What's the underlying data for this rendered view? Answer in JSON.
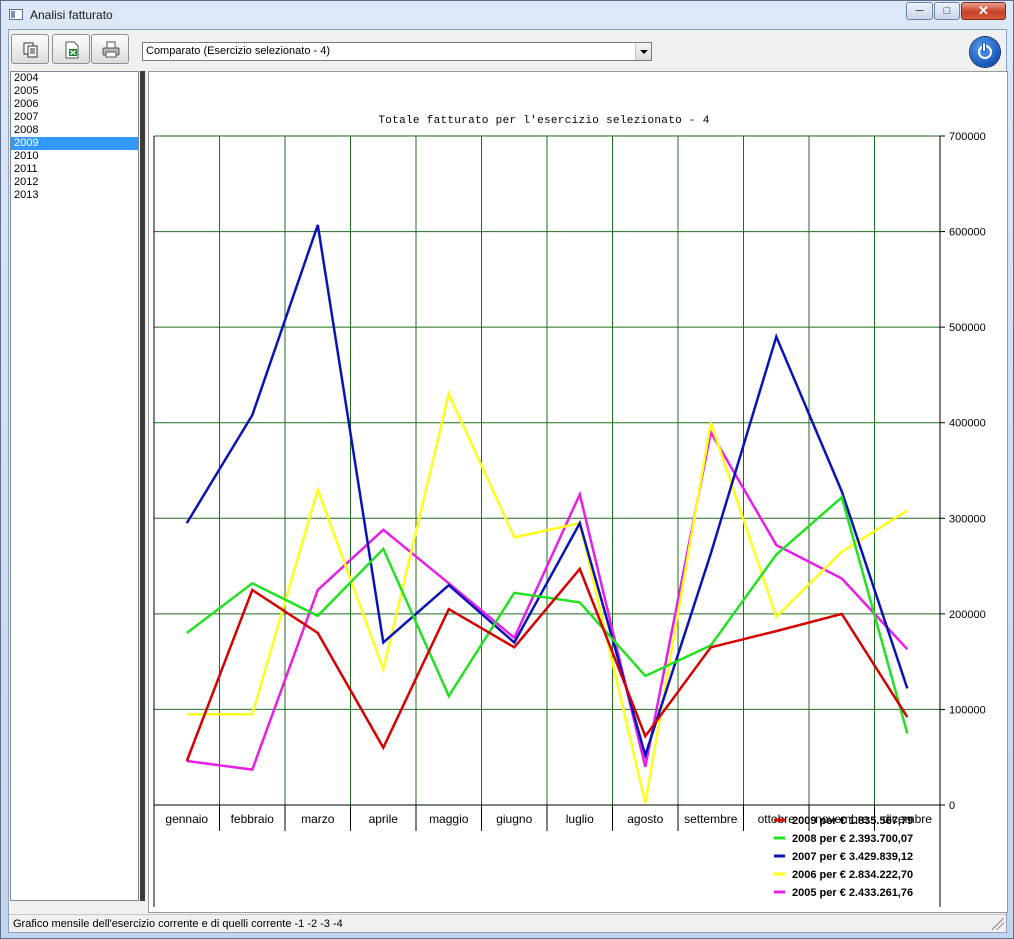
{
  "window": {
    "title": "Analisi fatturato",
    "minimize_glyph": "─",
    "maximize_glyph": "□",
    "close_glyph": "✕"
  },
  "toolbar": {
    "copy_icon": "copy-icon",
    "excel_icon": "excel-export-icon",
    "print_icon": "printer-icon",
    "power_icon": "power-icon"
  },
  "view_select": {
    "value": "Comparato (Esercizio selezionato - 4)"
  },
  "years": [
    "2004",
    "2005",
    "2006",
    "2007",
    "2008",
    "2009",
    "2010",
    "2011",
    "2012",
    "2013"
  ],
  "selected_year": "2009",
  "status": {
    "text": "Grafico mensile dell'esercizio corrente e di quelli corrente -1  -2  -3  -4"
  },
  "chart_data": {
    "type": "line",
    "title": "Totale fatturato per l'esercizio selezionato - 4",
    "categories": [
      "gennaio",
      "febbraio",
      "marzo",
      "aprile",
      "maggio",
      "giugno",
      "luglio",
      "agosto",
      "settembre",
      "ottobre",
      "novembre",
      "dicembre"
    ],
    "y_axis": {
      "min": 0,
      "max": 700000,
      "ticks": [
        0,
        100000,
        200000,
        300000,
        400000,
        500000,
        600000,
        700000
      ],
      "position": "right"
    },
    "grid": true,
    "legend_position": "bottom-right",
    "series": [
      {
        "name": "2009 per € 1.835.567,79",
        "color": "#d40000",
        "values": [
          46000,
          225000,
          180000,
          60000,
          205000,
          165000,
          247000,
          72000,
          165000,
          182000,
          200000,
          92000
        ]
      },
      {
        "name": "2008 per € 2.393.700,07",
        "color": "#22e022",
        "values": [
          180000,
          232000,
          198000,
          268000,
          114000,
          222000,
          212000,
          135000,
          167000,
          262000,
          322000,
          75000
        ]
      },
      {
        "name": "2007 per € 3.429.839,12",
        "color": "#0a14b4",
        "values": [
          295000,
          408000,
          607000,
          170000,
          230000,
          170000,
          295000,
          52000,
          263000,
          490000,
          328000,
          122000
        ]
      },
      {
        "name": "2006 per € 2.834.222,70",
        "color": "#ffff1e",
        "values": [
          95000,
          95000,
          330000,
          142000,
          430000,
          280000,
          295000,
          2000,
          400000,
          197000,
          265000,
          308000
        ]
      },
      {
        "name": "2005 per € 2.433.261,76",
        "color": "#e61ee6",
        "values": [
          46000,
          37000,
          225000,
          288000,
          232000,
          175000,
          325000,
          40000,
          390000,
          272000,
          237000,
          163000
        ]
      }
    ]
  }
}
